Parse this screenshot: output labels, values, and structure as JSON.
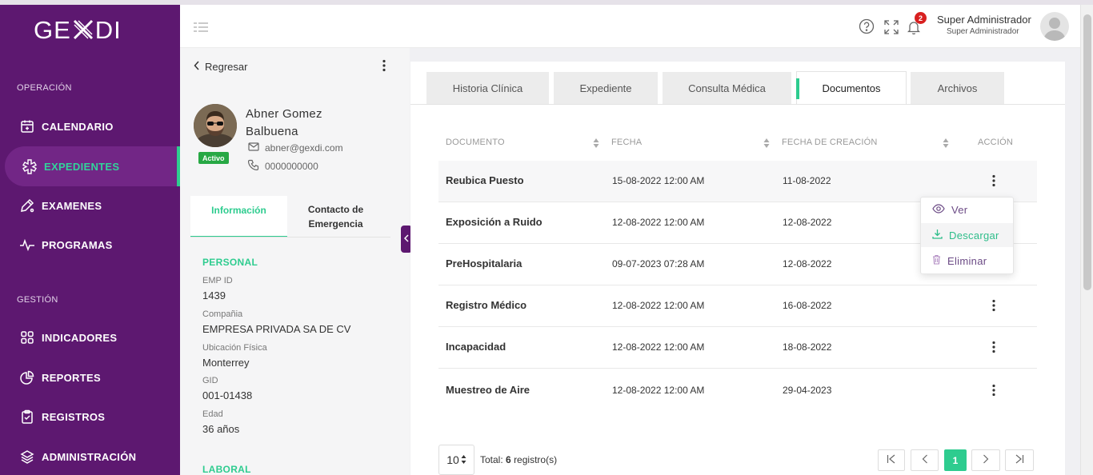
{
  "sidebar": {
    "logo": "GEXDI",
    "sections": [
      {
        "title": "OPERACIÓN",
        "items": [
          "CALENDARIO",
          "EXPEDIENTES",
          "EXAMENES",
          "PROGRAMAS"
        ]
      },
      {
        "title": "GESTIÓN",
        "items": [
          "INDICADORES",
          "REPORTES",
          "REGISTROS",
          "ADMINISTRACIÓN"
        ]
      }
    ],
    "active_item": "EXPEDIENTES",
    "accent_color": "#2ecc8f",
    "bg_color": "#5d1870"
  },
  "header": {
    "notifications_count": "2",
    "user_name": "Super Administrador",
    "user_role": "Super Administrador",
    "icons": [
      "menu-icon",
      "help-icon",
      "fullscreen-icon",
      "bell-icon"
    ]
  },
  "patient": {
    "back_label": "Regresar",
    "name": "Abner Gomez Balbuena",
    "status": "Activo",
    "email": "abner@gexdi.com",
    "phone": "0000000000",
    "tabs": [
      "Información",
      "Contacto de Emergencia"
    ],
    "personal_title": "PERSONAL",
    "fields": [
      {
        "label": "EMP ID",
        "value": "1439"
      },
      {
        "label": "Compañia",
        "value": "EMPRESA PRIVADA SA DE CV"
      },
      {
        "label": "Ubicación Física",
        "value": "Monterrey"
      },
      {
        "label": "GID",
        "value": "001-01438"
      },
      {
        "label": "Edad",
        "value": "36 años"
      }
    ],
    "laboral_title": "LABORAL"
  },
  "main": {
    "tabs": [
      "Historia Clínica",
      "Expediente",
      "Consulta Médica",
      "Documentos",
      "Archivos"
    ],
    "active_tab": "Documentos",
    "columns": [
      "DOCUMENTO",
      "FECHA",
      "FECHA DE CREACIÓN",
      "ACCIÓN"
    ],
    "rows": [
      {
        "documento": "Reubica Puesto",
        "fecha": "15-08-2022 12:00 AM",
        "creacion": "11-08-2022"
      },
      {
        "documento": "Exposición a Ruido",
        "fecha": "12-08-2022 12:00 AM",
        "creacion": "12-08-2022"
      },
      {
        "documento": "PreHospitalaria",
        "fecha": "09-07-2023 07:28 AM",
        "creacion": "12-08-2022"
      },
      {
        "documento": "Registro Médico",
        "fecha": "12-08-2022 12:00 AM",
        "creacion": "16-08-2022"
      },
      {
        "documento": "Incapacidad",
        "fecha": "12-08-2022 12:00 AM",
        "creacion": "18-08-2022"
      },
      {
        "documento": "Muestreo de Aire",
        "fecha": "12-08-2022 12:00 AM",
        "creacion": "29-04-2023"
      }
    ],
    "dropdown": [
      "Ver",
      "Descargar",
      "Eliminar"
    ],
    "page_size": "10",
    "total_label": "Total:",
    "total_count": "6",
    "total_suffix": "registro(s)",
    "current_page": "1"
  }
}
